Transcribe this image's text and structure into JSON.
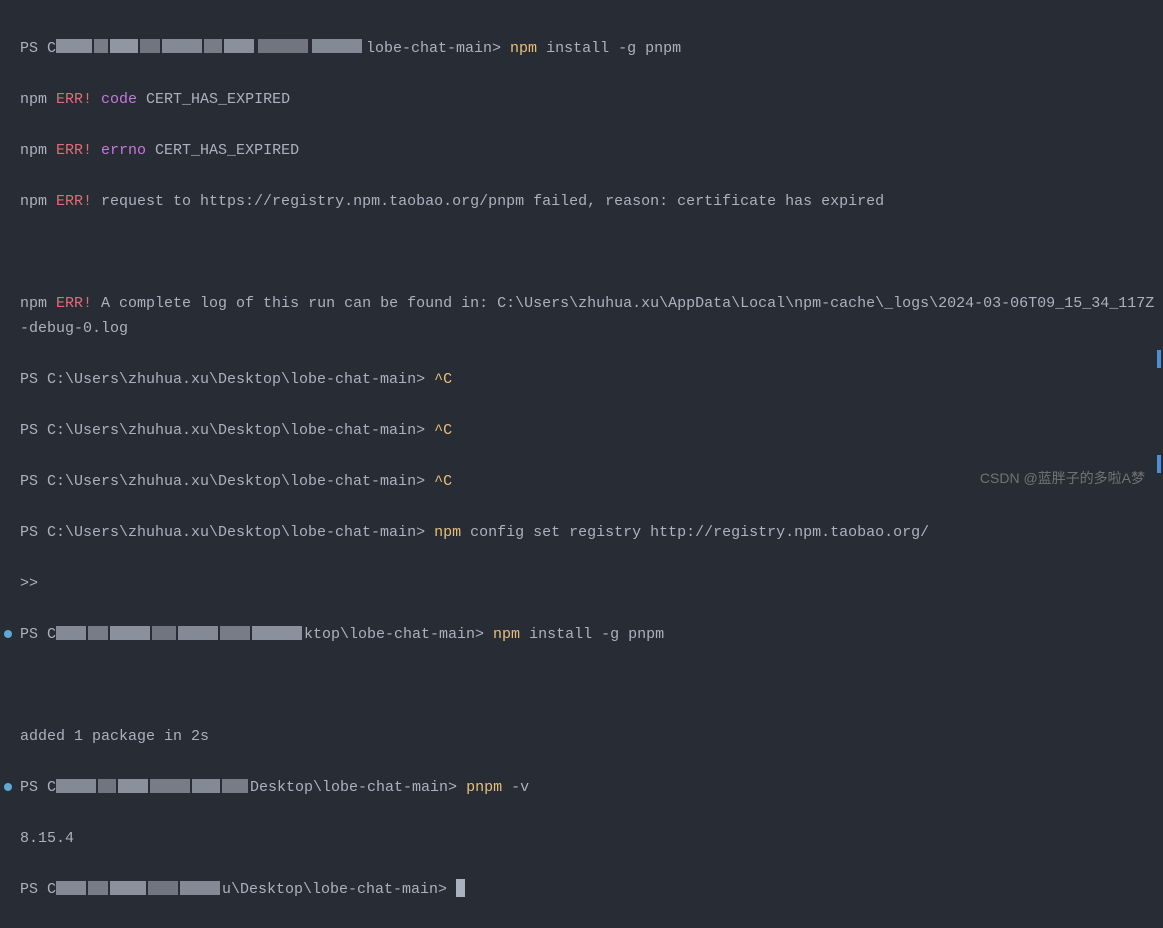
{
  "lines": {
    "l1_prefix": "PS C",
    "l1_suffix": "lobe-chat-main> ",
    "l1_cmd": "npm",
    "l1_args": " install -g pnpm",
    "l2_npm": "npm ",
    "l2_err": "ERR!",
    "l2_key": " code",
    "l2_val": " CERT_HAS_EXPIRED",
    "l3_npm": "npm ",
    "l3_err": "ERR!",
    "l3_key": " errno",
    "l3_val": " CERT_HAS_EXPIRED",
    "l4_npm": "npm ",
    "l4_err": "ERR!",
    "l4_msg": " request to https://registry.npm.taobao.org/pnpm failed, reason: certificate has expired",
    "l5_npm": "npm ",
    "l5_err": "ERR!",
    "l5_msg": " A complete log of this run can be found in: C:\\Users\\zhuhua.xu\\AppData\\Local\\npm-cache\\_logs\\2024-03-06T09_15_34_117Z-debug-0.log",
    "l6_prompt": "PS C:\\Users\\zhuhua.xu\\Desktop\\lobe-chat-main> ",
    "l6_ctrl": "^C",
    "l7_prompt": "PS C:\\Users\\zhuhua.xu\\Desktop\\lobe-chat-main> ",
    "l7_ctrl": "^C",
    "l8_prompt": "PS C:\\Users\\zhuhua.xu\\Desktop\\lobe-chat-main> ",
    "l8_ctrl": "^C",
    "l9_prompt": "PS C:\\Users\\zhuhua.xu\\Desktop\\lobe-chat-main> ",
    "l9_cmd": "npm",
    "l9_args": " config set registry http://registry.npm.taobao.org/",
    "l10_cont": ">>",
    "l11_prefix": "PS C",
    "l11_suffix": "ktop\\lobe-chat-main> ",
    "l11_cmd": "npm",
    "l11_args": " install -g pnpm",
    "l12_blank": "",
    "l13_output": "added 1 package in 2s",
    "l14_prefix": "PS C",
    "l14_suffix": "Desktop\\lobe-chat-main> ",
    "l14_cmd": "pnpm",
    "l14_flag": " -v",
    "l15_output": "8.15.4",
    "l16_prefix": "PS C",
    "l16_suffix": "u\\Desktop\\lobe-chat-main> "
  },
  "watermark": "CSDN @蓝胖子的多啦A梦"
}
